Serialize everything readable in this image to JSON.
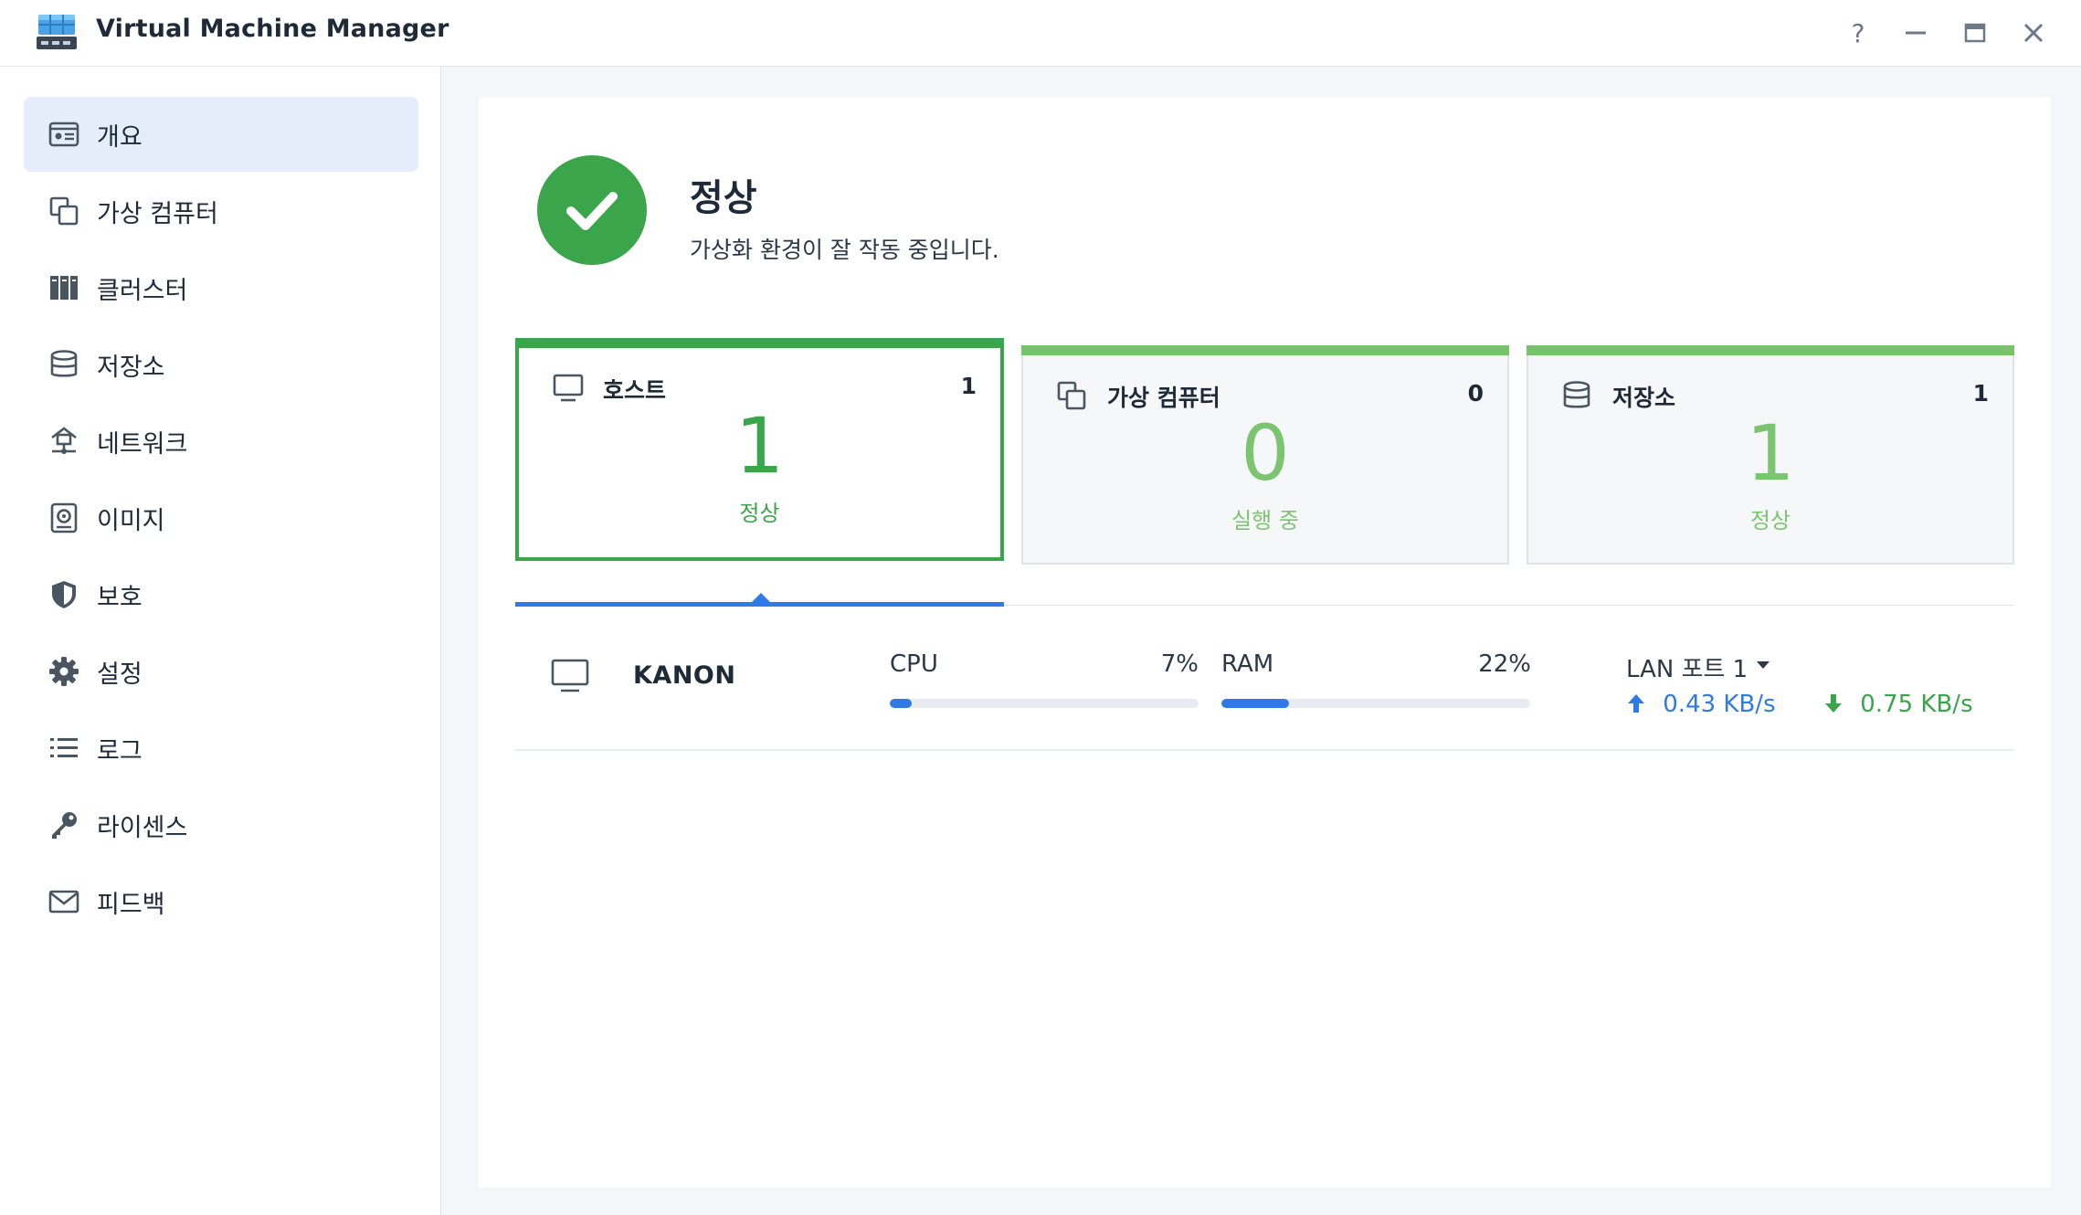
{
  "app": {
    "title": "Virtual Machine Manager"
  },
  "window_controls": {
    "help": "?"
  },
  "sidebar": {
    "items": [
      {
        "label": "개요",
        "icon": "overview-icon"
      },
      {
        "label": "가상 컴퓨터",
        "icon": "virtual-machine-icon"
      },
      {
        "label": "클러스터",
        "icon": "cluster-icon"
      },
      {
        "label": "저장소",
        "icon": "storage-icon"
      },
      {
        "label": "네트워크",
        "icon": "network-icon"
      },
      {
        "label": "이미지",
        "icon": "image-icon"
      },
      {
        "label": "보호",
        "icon": "shield-icon"
      },
      {
        "label": "설정",
        "icon": "gear-icon"
      },
      {
        "label": "로그",
        "icon": "list-icon"
      },
      {
        "label": "라이센스",
        "icon": "key-icon"
      },
      {
        "label": "피드백",
        "icon": "mail-icon"
      }
    ],
    "active_index": 0
  },
  "status": {
    "title": "정상",
    "subtitle": "가상화 환경이 잘 작동 중입니다.",
    "color": "#3aa54a"
  },
  "cards": [
    {
      "title": "호스트",
      "count": "1",
      "big": "1",
      "state": "정상",
      "selected": true
    },
    {
      "title": "가상 컴퓨터",
      "count": "0",
      "big": "0",
      "state": "실행 중",
      "selected": false
    },
    {
      "title": "저장소",
      "count": "1",
      "big": "1",
      "state": "정상",
      "selected": false
    }
  ],
  "host": {
    "name": "KANON",
    "cpu": {
      "label": "CPU",
      "value": "7%",
      "fraction": 0.07
    },
    "ram": {
      "label": "RAM",
      "value": "22%",
      "fraction": 0.22
    },
    "lan": {
      "label": "LAN 포트 1",
      "upload": "0.43 KB/s",
      "download": "0.75 KB/s"
    }
  },
  "colors": {
    "accent": "#2f7ae5",
    "ok": "#3aa54a",
    "ok_light": "#7cc570",
    "active_nav": "#e4edf9"
  }
}
